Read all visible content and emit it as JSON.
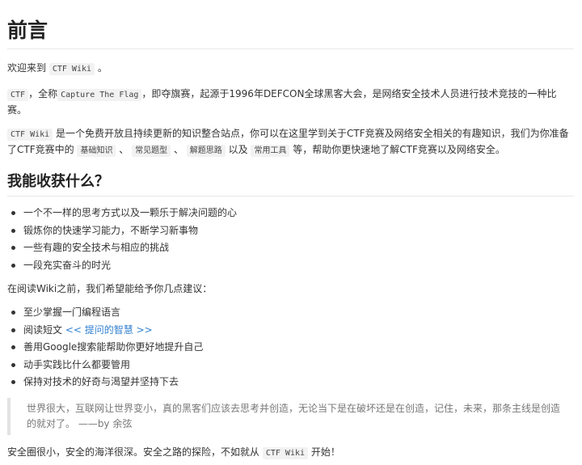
{
  "title": "前言",
  "intro": {
    "welcome_prefix": "欢迎来到",
    "welcome_code": "CTF Wiki",
    "welcome_suffix": "。",
    "p2_code1": "CTF",
    "p2_text1": "，全称",
    "p2_code2": "Capture The Flag",
    "p2_text2": "，即夺旗赛，起源于1996年DEFCON全球黑客大会，是网络安全技术人员进行技术竞技的一种比赛。",
    "p3_code1": "CTF Wiki",
    "p3_text1": "是一个免费开放且持续更新的知识整合站点，你可以在这里学到关于CTF竞赛及网络安全相关的有趣知识，我们为你准备了CTF竞赛中的",
    "p3_code2": "基础知识",
    "p3_sep1": "、",
    "p3_code3": "常见题型",
    "p3_sep2": "、",
    "p3_code4": "解题思路",
    "p3_text2": "以及",
    "p3_code5": "常用工具",
    "p3_text3": "等，帮助你更快速地了解CTF竞赛以及网络安全。"
  },
  "section": {
    "heading": "我能收获什么？",
    "gains": [
      "一个不一样的思考方式以及一颗乐于解决问题的心",
      "锻炼你的快速学习能力，不断学习新事物",
      "一些有趣的安全技术与相应的挑战",
      "一段充实奋斗的时光"
    ],
    "advice_intro": "在阅读Wiki之前，我们希望能给予你几点建议：",
    "advice": {
      "item1": "至少掌握一门编程语言",
      "item2_prefix": "阅读短文",
      "item2_link": "<< 提问的智慧 >>",
      "item3": "善用Google搜索能帮助你更好地提升自己",
      "item4": "动手实践比什么都要管用",
      "item5": "保持对技术的好奇与渴望并坚持下去"
    },
    "quote": "世界很大，互联网让世界变小，真的黑客们应该去思考并创造，无论当下是在破坏还是在创造，记住，未来，那条主线是创造的就对了。 ——by 余弦",
    "closing_prefix": "安全圈很小，安全的海洋很深。安全之路的探险，不如就从",
    "closing_code": "CTF Wiki",
    "closing_suffix": "开始！"
  }
}
